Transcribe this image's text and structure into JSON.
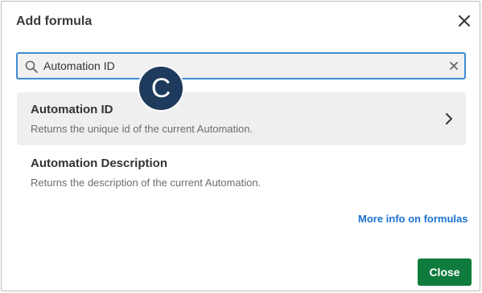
{
  "dialog": {
    "title": "Add formula",
    "close_icon": "close-icon"
  },
  "search": {
    "value": "Automation ID",
    "search_icon": "search-icon",
    "clear_icon": "clear-icon"
  },
  "results": [
    {
      "name": "Automation ID",
      "description": "Returns the unique id of the current Automation.",
      "highlighted": true,
      "icon": "chevron-right-icon"
    },
    {
      "name": "Automation Description",
      "description": "Returns the description of the current Automation."
    }
  ],
  "more_info_link": "More info on formulas",
  "close_button": "Close",
  "step_marker": "C",
  "colors": {
    "search_border": "#3f8ad3",
    "link": "#1a73d1",
    "primary_button": "#0f7b3d",
    "marker": "#1e3a5c"
  }
}
